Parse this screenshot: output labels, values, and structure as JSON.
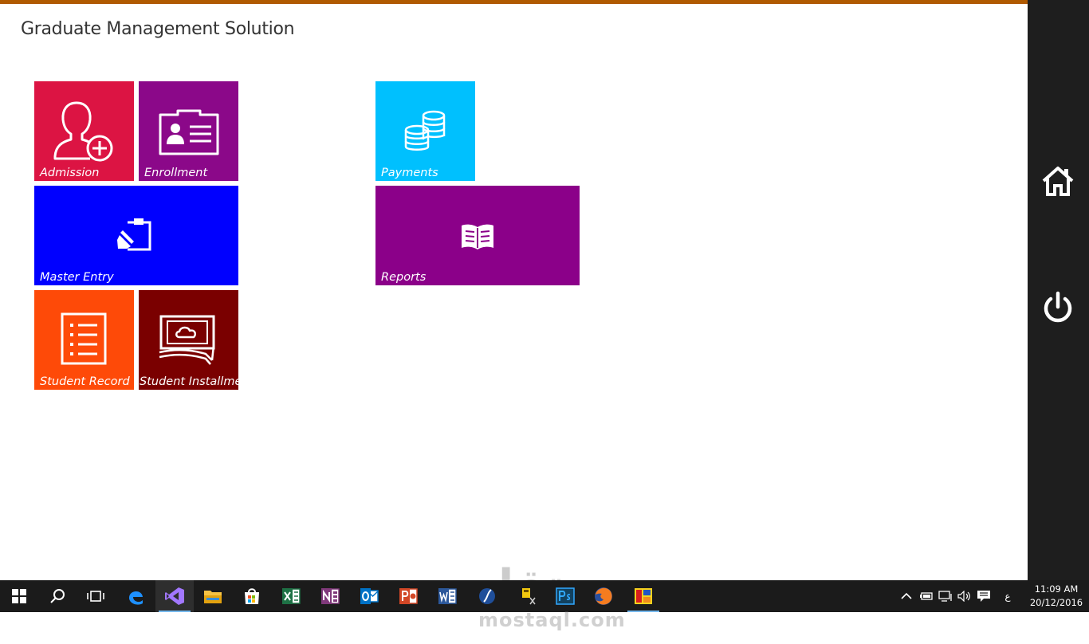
{
  "app": {
    "title": "Graduate Management Solution"
  },
  "tiles": [
    {
      "id": "admission",
      "label": "Admission",
      "color": "#dc1443",
      "icon": "user-add-icon"
    },
    {
      "id": "enrollment",
      "label": "Enrollment",
      "color": "#8b0889",
      "icon": "id-card-icon"
    },
    {
      "id": "master_entry",
      "label": "Master Entry",
      "color": "#0000ff",
      "icon": "clipboard-edit-icon"
    },
    {
      "id": "student_record",
      "label": "Student Record",
      "color": "#fe4a08",
      "icon": "list-document-icon"
    },
    {
      "id": "student_installment",
      "label": "Student Installment",
      "color": "#7a0000",
      "icon": "cloud-banknote-icon"
    },
    {
      "id": "payments",
      "label": "Payments",
      "color": "#00c0fe",
      "icon": "coins-stack-icon"
    },
    {
      "id": "reports",
      "label": "Reports",
      "color": "#8b0089",
      "icon": "open-book-icon"
    }
  ],
  "charm_bar": {
    "background": "#1e1e1e",
    "items": [
      "home-icon",
      "power-icon"
    ]
  },
  "taskbar": {
    "apps": [
      "windows-start-icon",
      "search-icon",
      "task-view-icon",
      "edge-icon",
      "visual-studio-icon",
      "file-explorer-icon",
      "store-icon",
      "excel-icon",
      "onenote-icon",
      "outlook-icon",
      "powerpoint-icon",
      "word-icon",
      "app-icon",
      "sticky-app-icon",
      "photoshop-icon",
      "firefox-icon",
      "running-app-icon"
    ],
    "tray": {
      "language": "ع"
    },
    "clock": {
      "time": "11:09 AM",
      "date": "20/12/2016"
    }
  },
  "watermark": {
    "arabic": "مستقل",
    "latin": "mostaql.com"
  },
  "colors": {
    "top_accent": "#b05a00",
    "taskbar": "#1b1b1b",
    "running_indicator": "#76b9ed"
  }
}
